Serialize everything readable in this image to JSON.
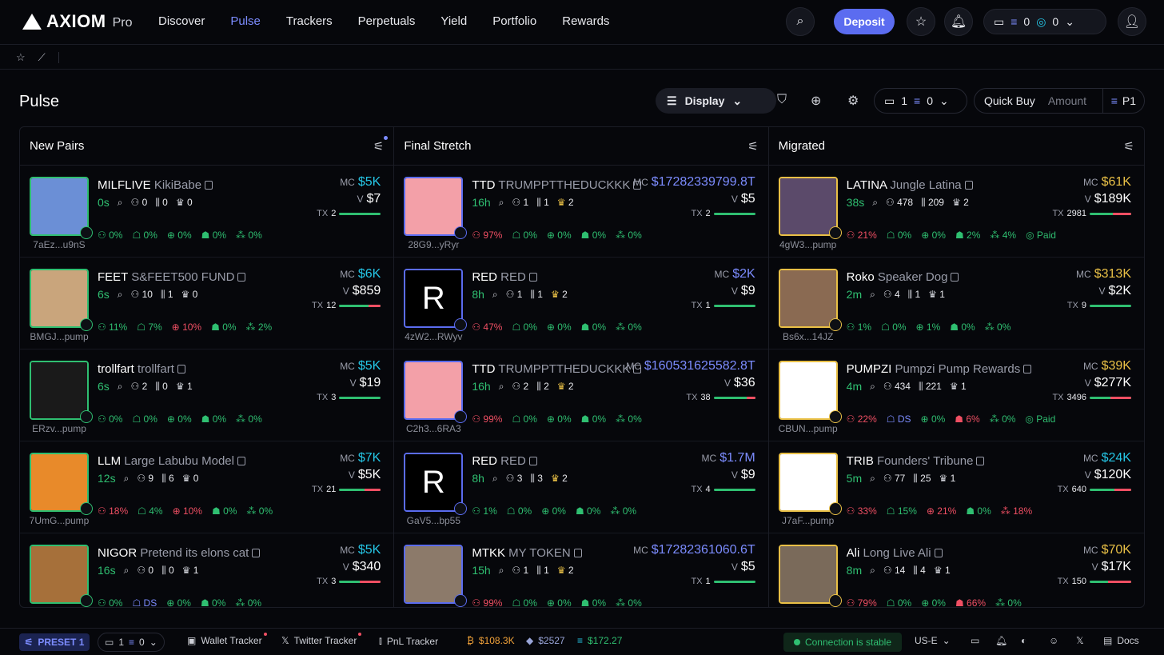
{
  "brand": {
    "name": "AXIOM",
    "suffix": "Pro"
  },
  "nav": {
    "items": [
      "Discover",
      "Pulse",
      "Trackers",
      "Perpetuals",
      "Yield",
      "Portfolio",
      "Rewards"
    ],
    "active": "Pulse"
  },
  "header": {
    "deposit_label": "Deposit",
    "wallet_count": "0",
    "wallet_count_2": "0"
  },
  "page": {
    "title": "Pulse",
    "display_label": "Display",
    "wallet_sel_count": "1",
    "wallet_sel_sol": "0",
    "quick_buy_label": "Quick Buy",
    "amount_placeholder": "Amount",
    "preset_label": "P1"
  },
  "columns": [
    {
      "title": "New Pairs",
      "rows": [
        {
          "sym": "MILFLIVE",
          "name": "KikiBabe",
          "age": "0s",
          "addr": "7aEz...u9nS",
          "mc": "$5K",
          "mc_color": "#25c6e6",
          "vol": "$7",
          "tx": "2",
          "tx_red": 0,
          "stats": [
            "0",
            "0",
            "0"
          ],
          "pcts": [
            [
              "0%",
              "g"
            ],
            [
              "0%",
              "g"
            ],
            [
              "0%",
              "g"
            ],
            [
              "0%",
              "g"
            ],
            [
              "0%",
              "g"
            ]
          ],
          "thumb": "#6b8fd6"
        },
        {
          "sym": "FEET",
          "name": "S&FEET500 FUND",
          "age": "6s",
          "addr": "BMGJ...pump",
          "mc": "$6K",
          "mc_color": "#25c6e6",
          "vol": "$859",
          "tx": "12",
          "tx_red": 30,
          "stats": [
            "10",
            "1",
            "0"
          ],
          "pcts": [
            [
              "11%",
              "g"
            ],
            [
              "7%",
              "g"
            ],
            [
              "10%",
              "r"
            ],
            [
              "0%",
              "g"
            ],
            [
              "2%",
              "g"
            ]
          ],
          "thumb": "#c9a57c"
        },
        {
          "sym": "trollfart",
          "name": "trollfart",
          "age": "6s",
          "addr": "ERzv...pump",
          "mc": "$5K",
          "mc_color": "#25c6e6",
          "vol": "$19",
          "tx": "3",
          "tx_red": 0,
          "stats": [
            "2",
            "0",
            "1"
          ],
          "pcts": [
            [
              "0%",
              "g"
            ],
            [
              "0%",
              "g"
            ],
            [
              "0%",
              "g"
            ],
            [
              "0%",
              "g"
            ],
            [
              "0%",
              "g"
            ]
          ],
          "thumb": "#1a1a1a"
        },
        {
          "sym": "LLM",
          "name": "Large Labubu Model",
          "age": "12s",
          "addr": "7UmG...pump",
          "mc": "$7K",
          "mc_color": "#25c6e6",
          "vol": "$5K",
          "tx": "21",
          "tx_red": 40,
          "stats": [
            "9",
            "6",
            "0"
          ],
          "pcts": [
            [
              "18%",
              "r"
            ],
            [
              "4%",
              "g"
            ],
            [
              "10%",
              "r"
            ],
            [
              "0%",
              "g"
            ],
            [
              "0%",
              "g"
            ]
          ],
          "thumb": "#e88a2a"
        },
        {
          "sym": "NIGOR",
          "name": "Pretend its elons cat",
          "age": "16s",
          "addr": "",
          "mc": "$5K",
          "mc_color": "#25c6e6",
          "vol": "$340",
          "tx": "3",
          "tx_red": 50,
          "stats": [
            "0",
            "0",
            "1"
          ],
          "pcts": [
            [
              "0%",
              "g"
            ],
            [
              "DS",
              "b"
            ],
            [
              "0%",
              "g"
            ],
            [
              "0%",
              "g"
            ],
            [
              "0%",
              "g"
            ]
          ],
          "thumb": "#a6703a"
        }
      ]
    },
    {
      "title": "Final Stretch",
      "rows": [
        {
          "sym": "TTD",
          "name": "TRUMPPTTHEDUCKKK",
          "age": "16h",
          "addr": "28G9...yRyr",
          "mc": "$17282339799.8T",
          "mc_color": "#7c8cff",
          "vol": "$5",
          "tx": "2",
          "tx_red": 0,
          "stats": [
            "1",
            "1",
            "2"
          ],
          "pcts": [
            [
              "97%",
              "r"
            ],
            [
              "0%",
              "g"
            ],
            [
              "0%",
              "g"
            ],
            [
              "0%",
              "g"
            ],
            [
              "0%",
              "g"
            ]
          ],
          "thumb": "#f3a0a8"
        },
        {
          "sym": "RED",
          "name": "RED",
          "age": "8h",
          "addr": "4zW2...RWyv",
          "mc": "$2K",
          "mc_color": "#7c8cff",
          "vol": "$9",
          "tx": "1",
          "tx_red": 0,
          "stats": [
            "1",
            "1",
            "2"
          ],
          "pcts": [
            [
              "47%",
              "r"
            ],
            [
              "0%",
              "g"
            ],
            [
              "0%",
              "g"
            ],
            [
              "0%",
              "g"
            ],
            [
              "0%",
              "g"
            ]
          ],
          "thumb": "#000000"
        },
        {
          "sym": "TTD",
          "name": "TRUMPPTTHEDUCKKK",
          "age": "16h",
          "addr": "C2h3...6RA3",
          "mc": "$160531625582.8T",
          "mc_color": "#7c8cff",
          "vol": "$36",
          "tx": "38",
          "tx_red": 20,
          "stats": [
            "2",
            "2",
            "2"
          ],
          "pcts": [
            [
              "99%",
              "r"
            ],
            [
              "0%",
              "g"
            ],
            [
              "0%",
              "g"
            ],
            [
              "0%",
              "g"
            ],
            [
              "0%",
              "g"
            ]
          ],
          "thumb": "#f3a0a8"
        },
        {
          "sym": "RED",
          "name": "RED",
          "age": "8h",
          "addr": "GaV5...bp55",
          "mc": "$1.7M",
          "mc_color": "#7c8cff",
          "vol": "$9",
          "tx": "4",
          "tx_red": 0,
          "stats": [
            "3",
            "3",
            "2"
          ],
          "pcts": [
            [
              "1%",
              "g"
            ],
            [
              "0%",
              "g"
            ],
            [
              "0%",
              "g"
            ],
            [
              "0%",
              "g"
            ],
            [
              "0%",
              "g"
            ]
          ],
          "thumb": "#000000"
        },
        {
          "sym": "MTKK",
          "name": "MY TOKEN",
          "age": "15h",
          "addr": "",
          "mc": "$17282361060.6T",
          "mc_color": "#7c8cff",
          "vol": "$5",
          "tx": "1",
          "tx_red": 0,
          "stats": [
            "1",
            "1",
            "2"
          ],
          "pcts": [
            [
              "99%",
              "r"
            ],
            [
              "0%",
              "g"
            ],
            [
              "0%",
              "g"
            ],
            [
              "0%",
              "g"
            ],
            [
              "0%",
              "g"
            ]
          ],
          "thumb": "#8c7a6a"
        }
      ]
    },
    {
      "title": "Migrated",
      "rows": [
        {
          "sym": "LATINA",
          "name": "Jungle Latina",
          "age": "38s",
          "addr": "4gW3...pump",
          "mc": "$61K",
          "mc_color": "#e9c046",
          "vol": "$189K",
          "tx": "2981",
          "tx_red": 45,
          "stats": [
            "478",
            "209",
            "2"
          ],
          "pcts": [
            [
              "21%",
              "r"
            ],
            [
              "0%",
              "g"
            ],
            [
              "0%",
              "g"
            ],
            [
              "2%",
              "g"
            ],
            [
              "4%",
              "g"
            ],
            [
              "Paid",
              "g"
            ]
          ],
          "thumb": "#5b4a6a"
        },
        {
          "sym": "Roko",
          "name": "Speaker Dog",
          "age": "2m",
          "addr": "Bs6x...14JZ",
          "mc": "$313K",
          "mc_color": "#e9c046",
          "vol": "$2K",
          "tx": "9",
          "tx_red": 0,
          "stats": [
            "4",
            "1",
            "1"
          ],
          "pcts": [
            [
              "1%",
              "g"
            ],
            [
              "0%",
              "g"
            ],
            [
              "1%",
              "g"
            ],
            [
              "0%",
              "g"
            ],
            [
              "0%",
              "g"
            ]
          ],
          "thumb": "#8a6a52"
        },
        {
          "sym": "PUMPZI",
          "name": "Pumpzi Pump Rewards",
          "age": "4m",
          "addr": "CBUN...pump",
          "mc": "$39K",
          "mc_color": "#e9c046",
          "vol": "$277K",
          "tx": "3496",
          "tx_red": 50,
          "stats": [
            "434",
            "221",
            "1"
          ],
          "pcts": [
            [
              "22%",
              "r"
            ],
            [
              "DS",
              "b"
            ],
            [
              "0%",
              "g"
            ],
            [
              "6%",
              "r"
            ],
            [
              "0%",
              "g"
            ],
            [
              "Paid",
              "g"
            ]
          ],
          "thumb": "#ffffff"
        },
        {
          "sym": "TRIB",
          "name": "Founders' Tribune",
          "age": "5m",
          "addr": "J7aF...pump",
          "mc": "$24K",
          "mc_color": "#25c6e6",
          "vol": "$120K",
          "tx": "640",
          "tx_red": 40,
          "stats": [
            "77",
            "25",
            "1"
          ],
          "pcts": [
            [
              "33%",
              "r"
            ],
            [
              "15%",
              "g"
            ],
            [
              "21%",
              "r"
            ],
            [
              "0%",
              "g"
            ],
            [
              "18%",
              "r"
            ]
          ],
          "thumb": "#ffffff"
        },
        {
          "sym": "Ali",
          "name": "Long Live Ali",
          "age": "8m",
          "addr": "",
          "mc": "$70K",
          "mc_color": "#e9c046",
          "vol": "$17K",
          "tx": "150",
          "tx_red": 55,
          "stats": [
            "14",
            "4",
            "1"
          ],
          "pcts": [
            [
              "79%",
              "r"
            ],
            [
              "0%",
              "g"
            ],
            [
              "0%",
              "g"
            ],
            [
              "66%",
              "r"
            ],
            [
              "0%",
              "g"
            ]
          ],
          "thumb": "#7a6a5a"
        }
      ]
    }
  ],
  "footer": {
    "preset": "PRESET 1",
    "wallet_count": "1",
    "wallet_sol": "0",
    "wallet_tracker": "Wallet Tracker",
    "twitter_tracker": "Twitter Tracker",
    "pnl_tracker": "PnL Tracker",
    "btc": "$108.3K",
    "eth": "$2527",
    "sol": "$172.27",
    "connection": "Connection is stable",
    "region": "US-E",
    "docs": "Docs"
  }
}
